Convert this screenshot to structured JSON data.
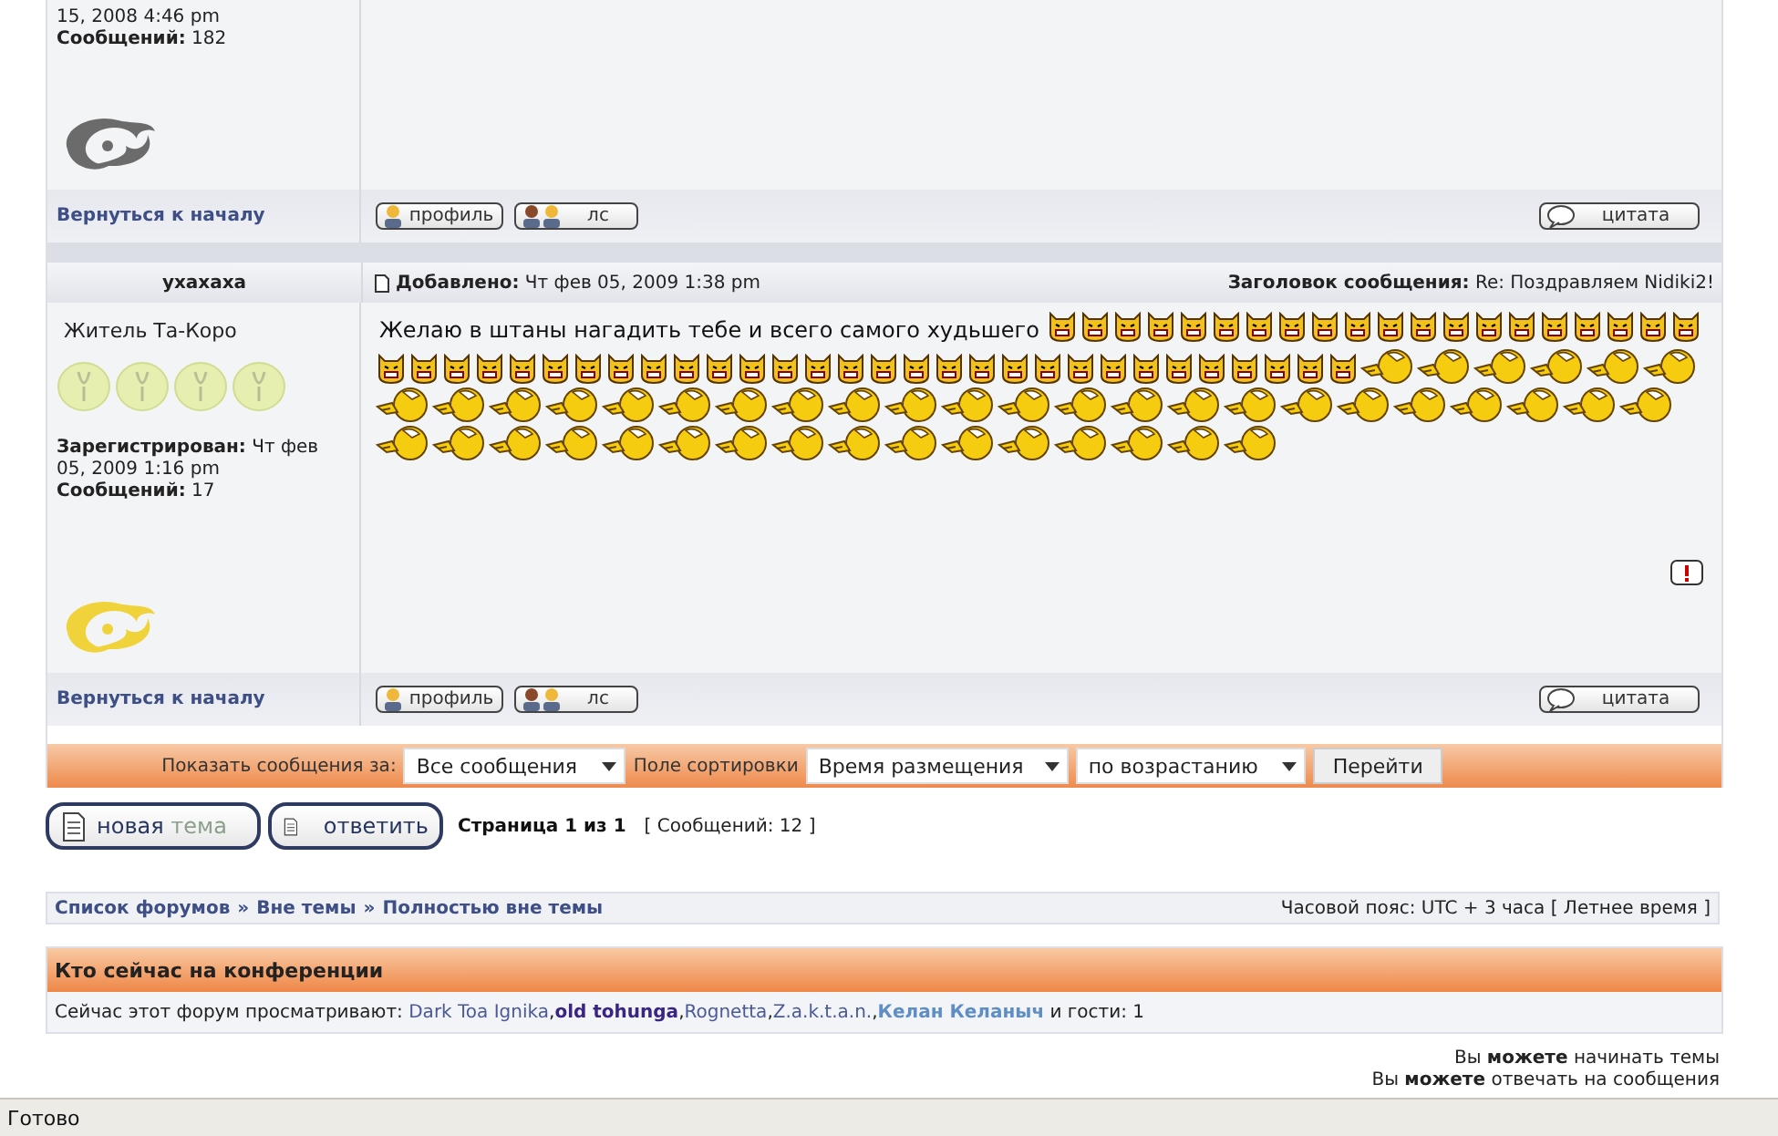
{
  "prev_post": {
    "registered_tail": "15, 2008 4:46 pm",
    "posts_label": "Сообщений:",
    "posts_value": "182",
    "back_link": "Вернуться к началу",
    "buttons": [
      {
        "kind": "profile",
        "label": "профиль"
      },
      {
        "kind": "pm",
        "label": "лс"
      }
    ],
    "quote_button": "цитата"
  },
  "post": {
    "author": "yxaxaxa",
    "added_label": "Добавлено:",
    "added_value": "Чт фев 05, 2009 1:38 pm",
    "subject_label": "Заголовок сообщения:",
    "subject_value": "Re: Поздравляем Nidiki2!",
    "rank_title": "Житель Та-Коро",
    "registered_label": "Зарегистрирован:",
    "registered_value": "Чт фев 05, 2009 1:16 pm",
    "posts_label": "Сообщений:",
    "posts_value": "17",
    "text": "Желаю в штаны нагадить тебе и всего самого худьшего",
    "smilies": [
      {
        "kind": "devil"
      },
      {
        "kind": "devil"
      },
      {
        "kind": "devil"
      },
      {
        "kind": "devil"
      },
      {
        "kind": "devil"
      },
      {
        "kind": "devil"
      },
      {
        "kind": "devil"
      },
      {
        "kind": "devil"
      },
      {
        "kind": "devil"
      },
      {
        "kind": "devil"
      },
      {
        "kind": "devil"
      },
      {
        "kind": "devil"
      },
      {
        "kind": "devil"
      },
      {
        "kind": "devil"
      },
      {
        "kind": "devil"
      },
      {
        "kind": "devil"
      },
      {
        "kind": "devil"
      },
      {
        "kind": "devil"
      },
      {
        "kind": "devil"
      },
      {
        "kind": "devil"
      },
      {
        "kind": "devil"
      },
      {
        "kind": "devil"
      },
      {
        "kind": "devil"
      },
      {
        "kind": "devil"
      },
      {
        "kind": "devil"
      },
      {
        "kind": "devil"
      },
      {
        "kind": "devil"
      },
      {
        "kind": "devil"
      },
      {
        "kind": "devil"
      },
      {
        "kind": "devil"
      },
      {
        "kind": "devil"
      },
      {
        "kind": "devil"
      },
      {
        "kind": "devil"
      },
      {
        "kind": "devil"
      },
      {
        "kind": "devil"
      },
      {
        "kind": "devil"
      },
      {
        "kind": "devil"
      },
      {
        "kind": "devil"
      },
      {
        "kind": "devil"
      },
      {
        "kind": "devil"
      },
      {
        "kind": "devil"
      },
      {
        "kind": "devil"
      },
      {
        "kind": "devil"
      },
      {
        "kind": "devil"
      },
      {
        "kind": "devil"
      },
      {
        "kind": "devil"
      },
      {
        "kind": "devil"
      },
      {
        "kind": "devil"
      },
      {
        "kind": "devil"
      },
      {
        "kind": "devil"
      },
      {
        "kind": "point"
      },
      {
        "kind": "point"
      },
      {
        "kind": "point"
      },
      {
        "kind": "point"
      },
      {
        "kind": "point"
      },
      {
        "kind": "point"
      },
      {
        "kind": "point"
      },
      {
        "kind": "point"
      },
      {
        "kind": "point"
      },
      {
        "kind": "point"
      },
      {
        "kind": "point"
      },
      {
        "kind": "point"
      },
      {
        "kind": "point"
      },
      {
        "kind": "point"
      },
      {
        "kind": "point"
      },
      {
        "kind": "point"
      },
      {
        "kind": "point"
      },
      {
        "kind": "point"
      },
      {
        "kind": "point"
      },
      {
        "kind": "point"
      },
      {
        "kind": "point"
      },
      {
        "kind": "point"
      },
      {
        "kind": "point"
      },
      {
        "kind": "point"
      },
      {
        "kind": "point"
      },
      {
        "kind": "point"
      },
      {
        "kind": "point"
      },
      {
        "kind": "point"
      },
      {
        "kind": "point"
      },
      {
        "kind": "point"
      },
      {
        "kind": "point"
      },
      {
        "kind": "point"
      },
      {
        "kind": "point"
      },
      {
        "kind": "point"
      },
      {
        "kind": "point"
      },
      {
        "kind": "point"
      },
      {
        "kind": "point"
      },
      {
        "kind": "point"
      },
      {
        "kind": "point"
      },
      {
        "kind": "point"
      },
      {
        "kind": "point"
      },
      {
        "kind": "point"
      },
      {
        "kind": "point"
      },
      {
        "kind": "point"
      },
      {
        "kind": "point"
      }
    ],
    "back_link": "Вернуться к началу",
    "buttons": [
      {
        "kind": "profile",
        "label": "профиль"
      },
      {
        "kind": "pm",
        "label": "лс"
      }
    ],
    "quote_button": "цитата"
  },
  "sort_bar": {
    "show_label": "Показать сообщения за:",
    "show_value": "Все сообщения",
    "sort_label": "Поле сортировки",
    "sort_value": "Время размещения",
    "order_value": "по возрастанию",
    "go_button": "Перейти"
  },
  "actions": {
    "new_topic": "новая",
    "new_topic_dim": "тема",
    "reply": "ответить",
    "page_info": "Страница 1 из 1",
    "count_info": "[ Сообщений: 12 ]"
  },
  "breadcrumb": {
    "items": [
      "Список форумов",
      "Вне темы",
      "Полностью вне темы"
    ],
    "separator": "»",
    "timezone": "Часовой пояс: UTC + 3 часа [ Летнее время ]"
  },
  "online": {
    "title": "Кто сейчас на конференции",
    "lead": "Сейчас этот форум просматривают:",
    "users": [
      {
        "name": "Dark Toa Ignika",
        "color": "#4a5a96",
        "bold": false
      },
      {
        "name": "old tohunga",
        "color": "#3a2484",
        "bold": true
      },
      {
        "name": "Rognetta",
        "color": "#4a5a96",
        "bold": false
      },
      {
        "name": "Z.a.k.t.a.n.",
        "color": "#4a5a96",
        "bold": false
      },
      {
        "name": "Келан Келаныч",
        "color": "#5e8ec4",
        "bold": true
      }
    ],
    "separator": ",",
    "tail": "и гости: 1"
  },
  "permissions": [
    "Вы **можете** начинать темы",
    "Вы **можете** отвечать на сообщения"
  ],
  "status_bar": {
    "text": "Готово"
  }
}
